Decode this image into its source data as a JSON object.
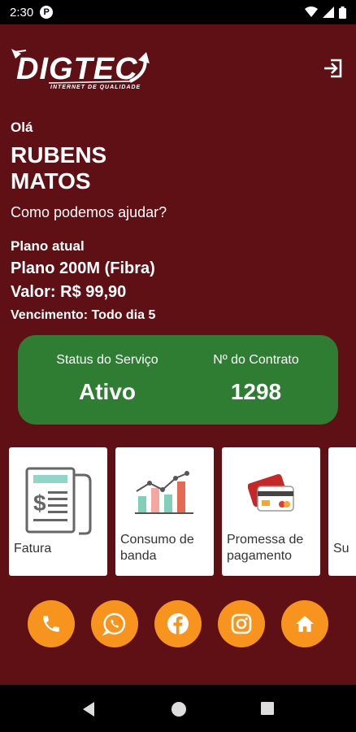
{
  "status_bar": {
    "time": "2:30",
    "app_badge": "P"
  },
  "brand": {
    "name": "DIGTEC",
    "tagline": "INTERNET DE QUALIDADE"
  },
  "greeting": {
    "hello": "Olá",
    "name": "RUBENS MATOS",
    "question": "Como podemos ajudar?"
  },
  "plan": {
    "label": "Plano atual",
    "name": "Plano 200M (Fibra)",
    "value": "Valor: R$ 99,90",
    "due": "Vencimento: Todo dia 5"
  },
  "service": {
    "status_label": "Status do Serviço",
    "status_value": "Ativo",
    "contract_label": "Nº do Contrato",
    "contract_value": "1298"
  },
  "cards": [
    {
      "label": "Fatura",
      "icon": "invoice-icon"
    },
    {
      "label": "Consumo de banda",
      "icon": "bar-chart-icon"
    },
    {
      "label": "Promessa de pagamento",
      "icon": "credit-card-icon"
    },
    {
      "label": "Su",
      "icon": ""
    }
  ],
  "social": [
    "phone-icon",
    "whatsapp-icon",
    "facebook-icon",
    "instagram-icon",
    "home-icon"
  ],
  "colors": {
    "background": "#5e1015",
    "status_card": "#2e7d32",
    "social_button": "#f7941d"
  }
}
